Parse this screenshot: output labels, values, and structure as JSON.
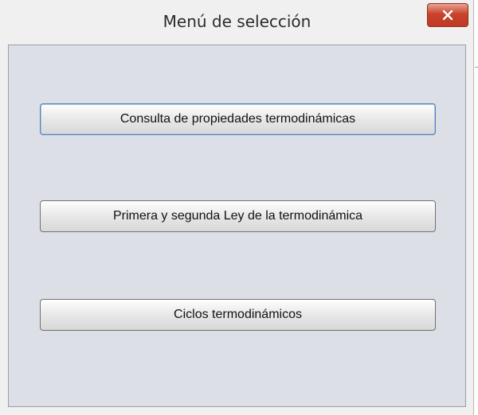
{
  "window": {
    "title": "Menú de selección",
    "close_icon": "close-icon",
    "accent_close": "#c8432c",
    "panel_bg": "#dcdfe6"
  },
  "menu": {
    "buttons": [
      {
        "label": "Consulta de propiedades termodinámicas"
      },
      {
        "label": "Primera y segunda Ley de la termodinámica"
      },
      {
        "label": "Ciclos termodinámicos"
      }
    ]
  }
}
